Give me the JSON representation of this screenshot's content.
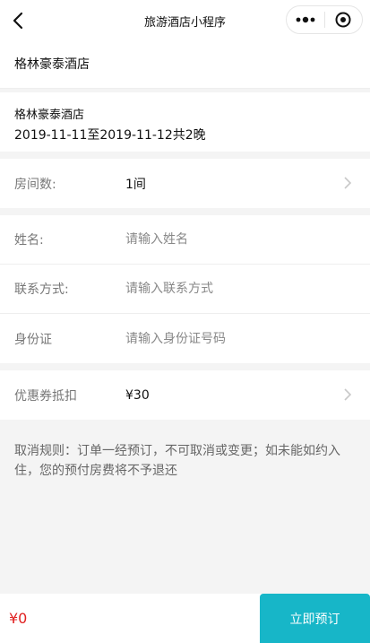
{
  "nav": {
    "title": "旅游酒店小程序",
    "back_icon": "back-arrow",
    "more_icon": "more-dots",
    "close_icon": "target-circle"
  },
  "hotel": {
    "name_header": "格林豪泰酒店",
    "name": "格林豪泰酒店",
    "dates": "2019-11-11至2019-11-12共2晚"
  },
  "rooms": {
    "label": "房间数:",
    "value": "1间"
  },
  "guest": {
    "name_label": "姓名:",
    "name_placeholder": "请输入姓名",
    "contact_label": "联系方式:",
    "contact_placeholder": "请输入联系方式",
    "id_label": "身份证",
    "id_placeholder": "请输入身份证号码"
  },
  "coupon": {
    "label": "优惠券抵扣",
    "value": "¥30"
  },
  "rules": {
    "text": "取消规则：订单一经预订，不可取消或变更；如未能如约入住，您的预付房费将不予退还"
  },
  "footer": {
    "price": "¥0",
    "book_label": "立即预订"
  },
  "colors": {
    "accent": "#17b6c8",
    "price": "#e02020"
  }
}
